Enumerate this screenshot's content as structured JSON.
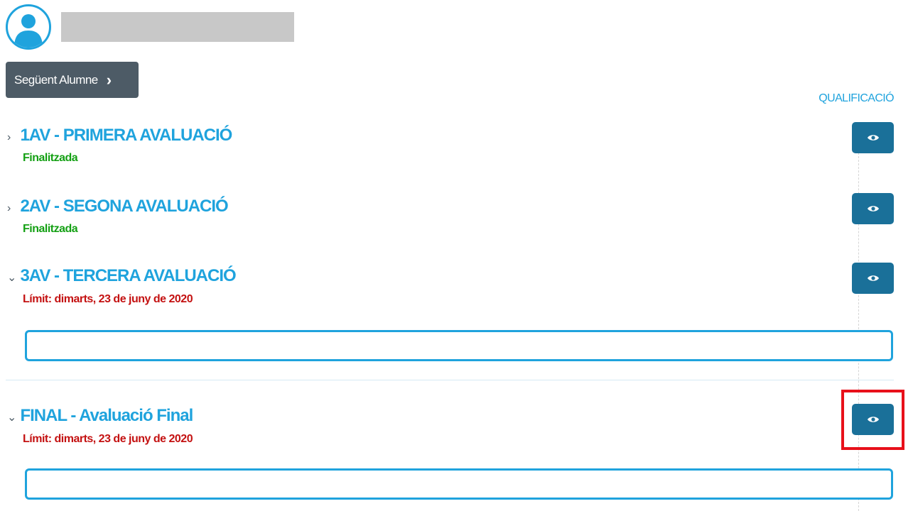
{
  "header": {
    "avatar_icon": "user-icon",
    "next_student_label": "Següent Alumne",
    "next_icon": "chevron-right-icon"
  },
  "columns": {
    "grade_label": "QUALIFICACIÓ"
  },
  "evaluations": [
    {
      "title": "1AV - PRIMERA AVALUACIÓ",
      "status": "Finalitzada",
      "status_color": "#14a014",
      "expanded": false
    },
    {
      "title": "2AV - SEGONA AVALUACIÓ",
      "status": "Finalitzada",
      "status_color": "#14a014",
      "expanded": false
    },
    {
      "title": "3AV - TERCERA AVALUACIÓ",
      "status": "Límit: dimarts, 23 de juny de 2020",
      "status_color": "#c41212",
      "expanded": true
    },
    {
      "title": "FINAL - Avaluació Final",
      "status": "Límit: dimarts, 23 de juny de 2020",
      "status_color": "#c41212",
      "expanded": true
    }
  ],
  "colors": {
    "accent": "#1fa3dd",
    "button_dark": "#1a7099",
    "next_button": "#4d5b66",
    "highlight": "#e8101a"
  },
  "icons": {
    "view": "eye-icon",
    "collapsed": "chevron-right-icon",
    "expanded": "chevron-down-icon"
  }
}
